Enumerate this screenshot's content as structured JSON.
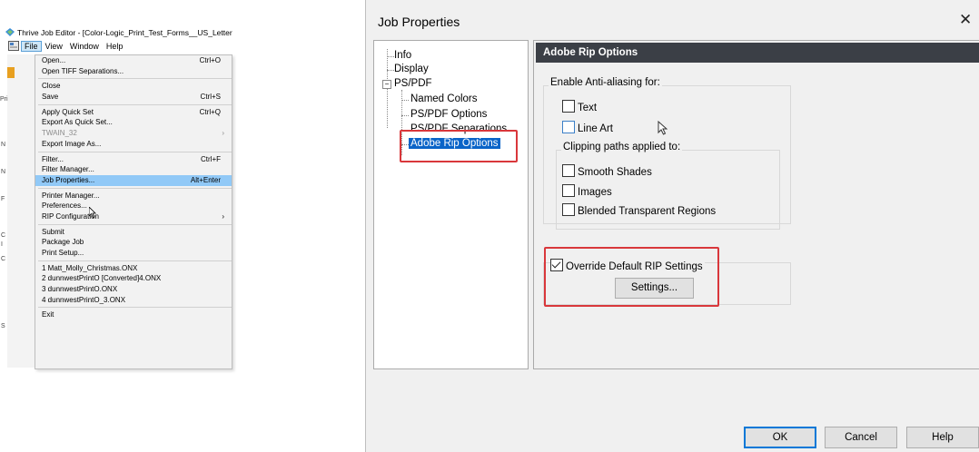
{
  "editor": {
    "title": "Thrive Job Editor - [Color-Logic_Print_Test_Forms__US_Letter",
    "menubar": [
      "File",
      "View",
      "Window",
      "Help"
    ],
    "background_fragments": [
      "Pri",
      "N",
      "N",
      "F",
      "C",
      "I",
      "C",
      "S"
    ]
  },
  "file_menu": {
    "items": [
      {
        "label": "Open...",
        "shortcut": "Ctrl+O"
      },
      {
        "label": "Open TIFF Separations..."
      },
      {
        "sep": true
      },
      {
        "label": "Close"
      },
      {
        "label": "Save",
        "shortcut": "Ctrl+S"
      },
      {
        "sep": true
      },
      {
        "label": "Apply Quick Set",
        "shortcut": "Ctrl+Q"
      },
      {
        "label": "Export As Quick Set..."
      },
      {
        "label": "TWAIN_32",
        "disabled": true,
        "submenu": true
      },
      {
        "label": "Export Image As..."
      },
      {
        "sep": true
      },
      {
        "label": "Filter...",
        "shortcut": "Ctrl+F"
      },
      {
        "label": "Filter Manager..."
      },
      {
        "label": "Job Properties...",
        "shortcut": "Alt+Enter",
        "highlighted": true
      },
      {
        "sep": true
      },
      {
        "label": "Printer Manager..."
      },
      {
        "label": "Preferences..."
      },
      {
        "label": "RIP Configuration",
        "submenu": true
      },
      {
        "sep": true
      },
      {
        "label": "Submit"
      },
      {
        "label": "Package Job"
      },
      {
        "label": "Print Setup..."
      },
      {
        "sep": true
      },
      {
        "label": "1 Matt_Molly_Christmas.ONX"
      },
      {
        "label": "2 dunnwestPrintO [Converted]4.ONX"
      },
      {
        "label": "3 dunnwestPrintO.ONX"
      },
      {
        "label": "4 dunnwestPrintO_3.ONX"
      },
      {
        "sep": true
      },
      {
        "label": "Exit"
      }
    ]
  },
  "dialog": {
    "title": "Job Properties",
    "close_glyph": "✕",
    "tree": {
      "info": "Info",
      "display": "Display",
      "ps_pdf": "PS/PDF",
      "named_colors": "Named Colors",
      "ps_pdf_options": "PS/PDF Options",
      "ps_pdf_separations": "PS/PDF Separations",
      "adobe_rip_options": "Adobe Rip Options",
      "expander": "−"
    },
    "panel": {
      "header": "Adobe Rip Options",
      "antialias_group": "Enable Anti-aliasing for:",
      "text_label": "Text",
      "line_art_label": "Line Art",
      "clipping_group": "Clipping paths applied to:",
      "smooth_shades_label": "Smooth Shades",
      "images_label": "Images",
      "blended_label": "Blended Transparent Regions",
      "override_label": "Override Default RIP Settings",
      "override_checked": true,
      "settings_button": "Settings..."
    },
    "buttons": {
      "ok": "OK",
      "cancel": "Cancel",
      "help": "Help"
    }
  },
  "colors": {
    "highlight": "#91c9f7",
    "selection": "#0a64c8",
    "callout": "#d9373b",
    "panel_header": "#3b3f46"
  }
}
